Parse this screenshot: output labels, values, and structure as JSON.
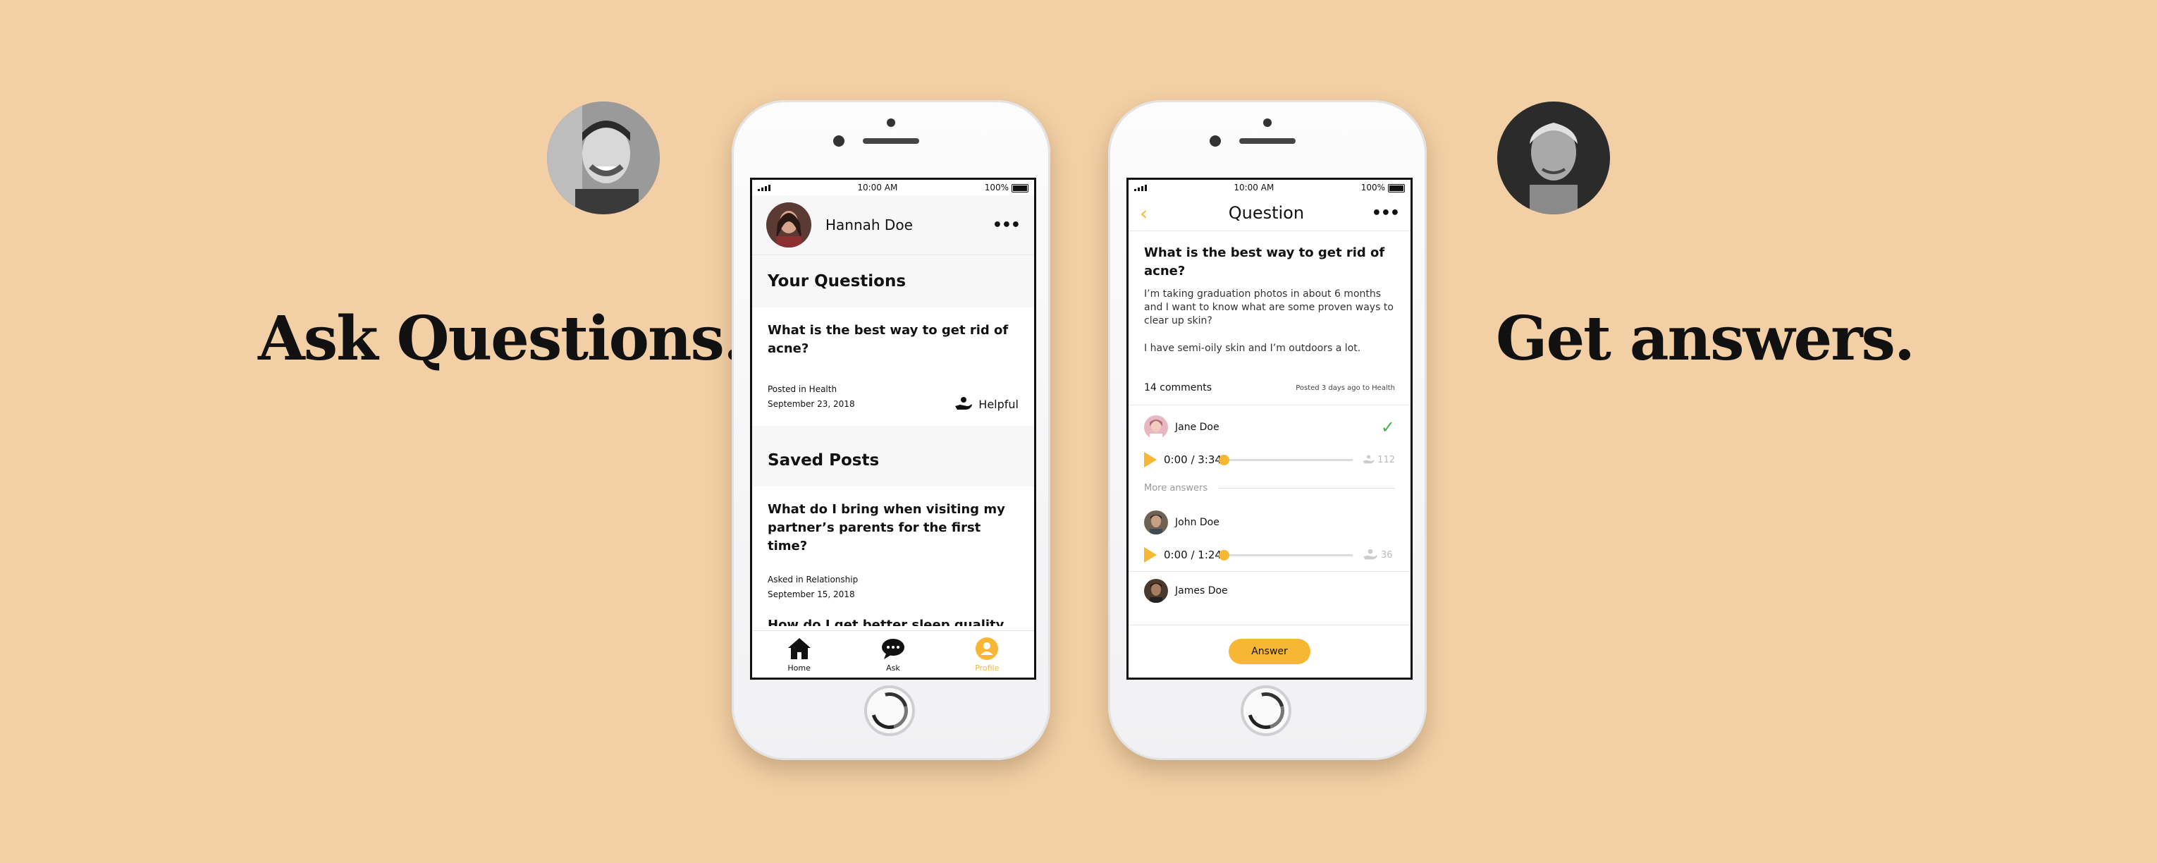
{
  "headlines": {
    "left": "Ask Questions.",
    "right": "Get answers."
  },
  "status_bar": {
    "time": "10:00 AM",
    "battery": "100%"
  },
  "profile_screen": {
    "user_name": "Hannah Doe",
    "more_icon": "more-dots-icon",
    "your_questions_title": "Your Questions",
    "question_post": {
      "title": "What is the best way to get rid of acne?",
      "posted_in": "Posted in Health",
      "date": "September 23, 2018",
      "helpful_label": "Helpful"
    },
    "saved_posts_title": "Saved Posts",
    "saved_post": {
      "title": "What do I bring when visiting my partner’s parents for the first time?",
      "asked_in": "Asked in Relationship",
      "date": "September 15, 2018"
    },
    "peek_post_title": "How do I get better sleep quality as a",
    "tabs": [
      {
        "label": "Home",
        "icon": "home-icon"
      },
      {
        "label": "Ask",
        "icon": "chat-bubble-icon"
      },
      {
        "label": "Profile",
        "icon": "profile-icon"
      }
    ],
    "active_tab_color": "#f7b633"
  },
  "question_screen": {
    "title": "Question",
    "heading": "What is the best way to get rid of acne?",
    "body1": "I’m taking graduation photos in about 6 months and I want to know what are some proven ways to clear up skin?",
    "body2": "I have semi-oily skin and I’m outdoors a lot.",
    "comments": "14 comments",
    "posted": "Posted 3 days ago to Health",
    "answers": [
      {
        "name": "Jane Doe",
        "time": "0:00 / 3:34",
        "likes": "112",
        "accepted": true
      },
      {
        "name": "John Doe",
        "time": "0:00 / 1:24",
        "likes": "36",
        "accepted": false
      }
    ],
    "more_answers_label": "More answers",
    "peek_answer_name": "James Doe",
    "answer_button": "Answer",
    "accent_color": "#f7b633"
  },
  "background_color": "#f2cfa5"
}
